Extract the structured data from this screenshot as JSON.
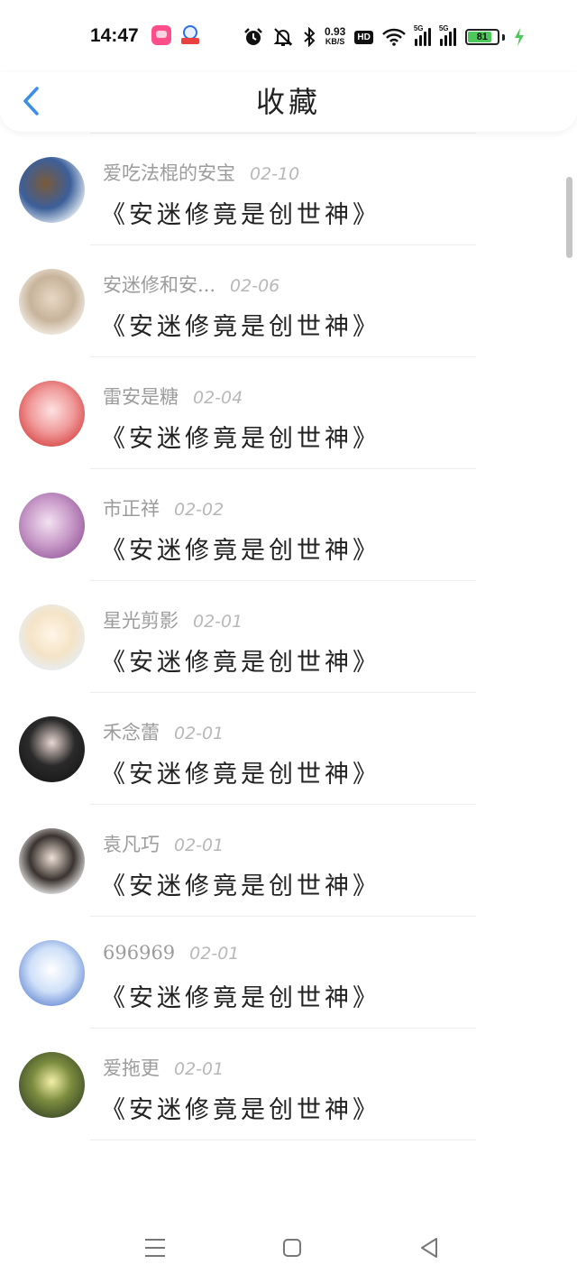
{
  "status_bar": {
    "time": "14:47",
    "net_speed_value": "0.93",
    "net_speed_unit": "KB/S",
    "hd_label": "HD",
    "sim1_label": "5G",
    "sim2_label": "5G",
    "battery_level": "81",
    "battery_fraction": 0.81,
    "icons": [
      "bilibili-app-icon",
      "app-notification-icon",
      "alarm-icon",
      "mute-icon",
      "bluetooth-icon",
      "wifi-icon",
      "signal-icon",
      "battery-icon",
      "charging-icon"
    ]
  },
  "header": {
    "title": "收藏",
    "back_icon": "chevron-left-icon"
  },
  "colors": {
    "accent": "#3a8ee6",
    "battery_fill": "#4cc95a",
    "charging": "#4cc95a"
  },
  "items": [
    {
      "author": "",
      "date": "",
      "title": "《安迷修竟是创世神》"
    },
    {
      "author": "爱吃法棍的安宝",
      "date": "02-10",
      "title": "《安迷修竟是创世神》"
    },
    {
      "author": "安迷修和安...",
      "date": "02-06",
      "title": "《安迷修竟是创世神》"
    },
    {
      "author": "雷安是糖",
      "date": "02-04",
      "title": "《安迷修竟是创世神》"
    },
    {
      "author": "市正祥",
      "date": "02-02",
      "title": "《安迷修竟是创世神》"
    },
    {
      "author": "星光剪影",
      "date": "02-01",
      "title": "《安迷修竟是创世神》"
    },
    {
      "author": "禾念蕾",
      "date": "02-01",
      "title": "《安迷修竟是创世神》"
    },
    {
      "author": "袁凡巧",
      "date": "02-01",
      "title": "《安迷修竟是创世神》"
    },
    {
      "author": "696969",
      "date": "02-01",
      "title": "《安迷修竟是创世神》"
    },
    {
      "author": "爱拖更",
      "date": "02-01",
      "title": "《安迷修竟是创世神》"
    }
  ],
  "nav_bar": {
    "icons": [
      "menu-icon",
      "home-square-icon",
      "back-triangle-icon"
    ]
  }
}
